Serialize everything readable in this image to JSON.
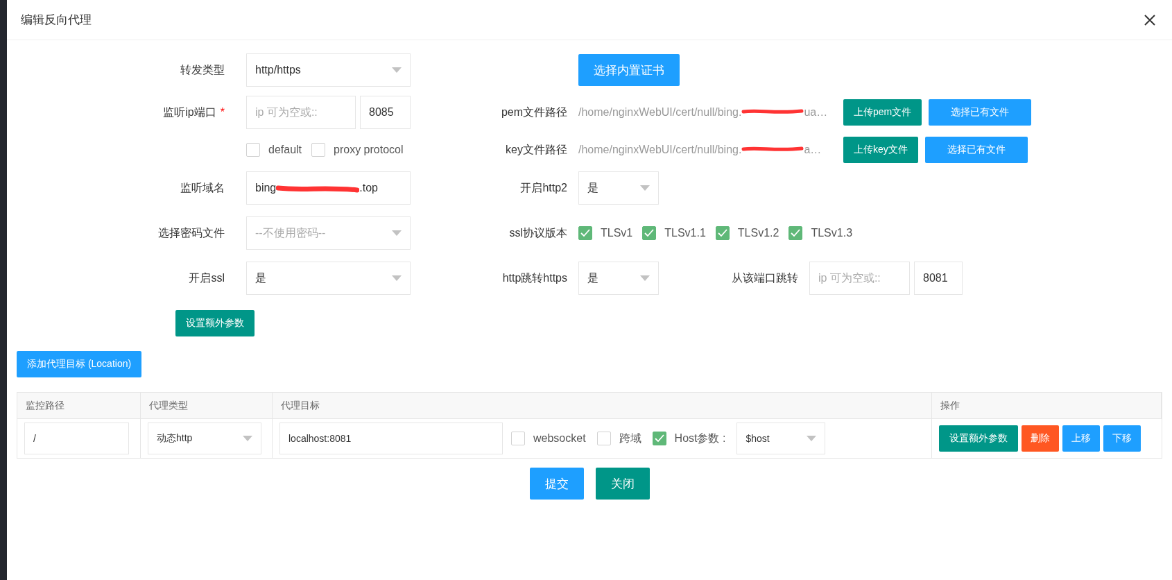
{
  "dialog": {
    "title": "编辑反向代理"
  },
  "forward_type": {
    "label": "转发类型",
    "value": "http/https"
  },
  "listen": {
    "label": "监听ip端口",
    "required": true,
    "required_mark": "*",
    "ip_placeholder": "ip 可为空或::",
    "port": "8085",
    "options": [
      {
        "label": "default",
        "checked": false
      },
      {
        "label": "proxy protocol",
        "checked": false
      }
    ]
  },
  "domain": {
    "label": "监听域名",
    "value_start": "bing",
    "value_end": ".top"
  },
  "password_file": {
    "label": "选择密码文件",
    "placeholder": "--不使用密码--"
  },
  "ssl": {
    "label": "开启ssl",
    "value": "是"
  },
  "extra_button": "设置额外参数",
  "cert_button": "选择内置证书",
  "cert_files": [
    {
      "label": "pem文件路径",
      "path": "/home/nginxWebUI/cert/null/bing.",
      "path_end": "ua…",
      "upload": "上传pem文件",
      "choose": "选择已有文件"
    },
    {
      "label": "key文件路径",
      "path": "/home/nginxWebUI/cert/null/bing.",
      "path_end": "a…",
      "upload": "上传key文件",
      "choose": "选择已有文件"
    }
  ],
  "http2": {
    "label": "开启http2",
    "value": "是"
  },
  "ssl_versions": {
    "label": "ssl协议版本",
    "items": [
      {
        "label": "TLSv1",
        "checked": true
      },
      {
        "label": "TLSv1.1",
        "checked": true
      },
      {
        "label": "TLSv1.2",
        "checked": true
      },
      {
        "label": "TLSv1.3",
        "checked": true
      }
    ]
  },
  "http_redirect": {
    "label": "http跳转https",
    "value": "是",
    "from_label": "从该端口跳转",
    "ip_placeholder": "ip 可为空或::",
    "port": "8081"
  },
  "add_location_button": "添加代理目标 (Location)",
  "locations_table": {
    "columns": [
      "监控路径",
      "代理类型",
      "代理目标",
      "操作"
    ],
    "rows": [
      {
        "path": "/",
        "type": "动态http",
        "target": "localhost:8081",
        "options": [
          {
            "label": "websocket",
            "checked": false
          },
          {
            "label": "跨域",
            "checked": false
          },
          {
            "label": "Host参数 :",
            "checked": true
          }
        ],
        "host_value": "$host",
        "actions": [
          {
            "label": "设置额外参数",
            "kind": "teal"
          },
          {
            "label": "删除",
            "kind": "danger"
          },
          {
            "label": "上移",
            "kind": "primary"
          },
          {
            "label": "下移",
            "kind": "primary"
          }
        ]
      }
    ]
  },
  "footer_buttons": [
    {
      "label": "提交",
      "kind": "primary"
    },
    {
      "label": "关闭",
      "kind": "teal"
    }
  ]
}
